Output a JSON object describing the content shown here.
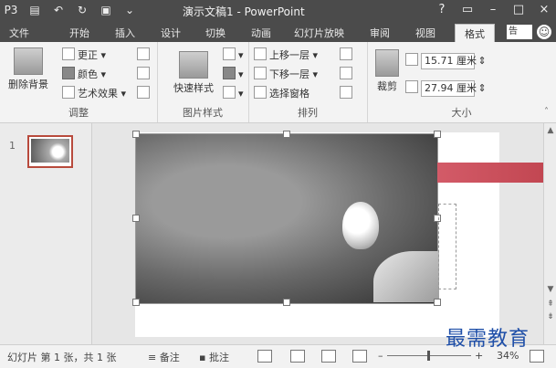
{
  "titlebar": {
    "qat": [
      "P3",
      "save",
      "undo",
      "redo",
      "start",
      "more"
    ],
    "title": "演示文稿1 - PowerPoint",
    "controls": [
      "?",
      "restore-ribbon",
      "–",
      "□",
      "×"
    ]
  },
  "tabs": [
    "文件",
    "开始",
    "插入",
    "设计",
    "切换",
    "动画",
    "幻灯片放映",
    "审阅",
    "视图",
    "格式"
  ],
  "search_box": "告",
  "ribbon": {
    "adjust": {
      "label": "调整",
      "remove_bg": "删除背景",
      "corrections": "更正 ▾",
      "color": "颜色 ▾",
      "artistic": "艺术效果 ▾"
    },
    "picture_styles": {
      "label": "图片样式",
      "quick_styles": "快速样式"
    },
    "arrange": {
      "label": "排列",
      "bring_forward": "上移一层 ▾",
      "send_backward": "下移一层 ▾",
      "selection_pane": "选择窗格"
    },
    "size": {
      "label": "大小",
      "crop": "裁剪",
      "height": "15.71 厘米",
      "width": "27.94 厘米"
    }
  },
  "thumbnails": [
    {
      "number": "1"
    }
  ],
  "status": {
    "slide_info": "幻灯片 第 1 张，共 1 张",
    "notes": "备注",
    "comments": "批注",
    "zoom": "34%"
  },
  "watermark": "最需教育"
}
